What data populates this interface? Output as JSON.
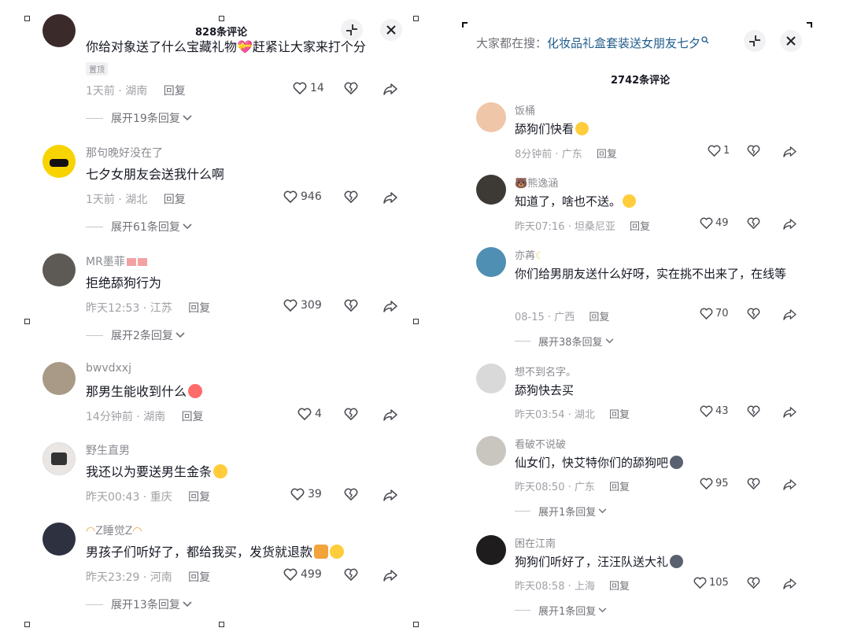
{
  "left": {
    "header": {
      "count_label": "828条评论"
    },
    "comments": [
      {
        "text": "你给对象送了什么宝藏礼物💝赶紧让大家来打个分",
        "pin": "置顶",
        "time": "1天前",
        "location": "湖南",
        "reply": "回复",
        "likes": "14",
        "expand": "展开19条回复"
      },
      {
        "user": "那句晚好没在了",
        "text": "七夕女朋友会送我什么啊",
        "time": "1天前",
        "location": "湖北",
        "reply": "回复",
        "likes": "946",
        "expand": "展开61条回复"
      },
      {
        "user": "MR墨菲",
        "text": "拒绝舔狗行为",
        "time": "昨天12:53",
        "location": "江苏",
        "reply": "回复",
        "likes": "309",
        "expand": "展开2条回复"
      },
      {
        "user": "bwvdxxj",
        "text": "那男生能收到什么",
        "time": "14分钟前",
        "location": "湖南",
        "reply": "回复",
        "likes": "4"
      },
      {
        "user": "野生直男",
        "text": "我还以为要送男生金条",
        "time": "昨天00:43",
        "location": "重庆",
        "reply": "回复",
        "likes": "39"
      },
      {
        "user": "Z睡觉Z",
        "text": "男孩子们听好了，都给我买，发货就退款",
        "time": "昨天23:29",
        "location": "河南",
        "reply": "回复",
        "likes": "499",
        "expand": "展开13条回复"
      }
    ]
  },
  "right": {
    "header": {
      "search_prefix": "大家都在搜：",
      "search_term": "化妆品礼盒套装送女朋友七夕",
      "count_label": "2742条评论"
    },
    "comments": [
      {
        "user": "饭桶",
        "text": "舔狗们快看",
        "time": "8分钟前",
        "location": "广东",
        "reply": "回复",
        "likes": "1"
      },
      {
        "user": "熊逸涵",
        "text": "知道了，啥也不送。",
        "time": "昨天07:16",
        "location": "坦桑尼亚",
        "reply": "回复",
        "likes": "49"
      },
      {
        "user": "亦苒",
        "text": "你们给男朋友送什么好呀，实在挑不出来了，在线等",
        "time": "08-15",
        "location": "广西",
        "reply": "回复",
        "likes": "70",
        "expand": "展开38条回复"
      },
      {
        "user": "想不到名字。",
        "text": "舔狗快去买",
        "time": "昨天03:54",
        "location": "湖北",
        "reply": "回复",
        "likes": "43"
      },
      {
        "user": "看破不说破",
        "text": "仙女们，快艾特你们的舔狗吧",
        "time": "昨天08:50",
        "location": "广东",
        "reply": "回复",
        "likes": "95",
        "expand": "展开1条回复"
      },
      {
        "user": "困在江南",
        "text": "狗狗们听好了，汪汪队送大礼",
        "time": "昨天08:58",
        "location": "上海",
        "reply": "回复",
        "likes": "105",
        "expand": "展开1条回复"
      }
    ]
  },
  "icons": {
    "heart": "heart-icon",
    "dislike": "broken-heart-icon",
    "share": "share-arrow-icon",
    "collapse": "collapse-arrows-icon",
    "close": "close-icon",
    "chevron": "chevron-down-icon",
    "search": "search-icon"
  },
  "colors": {
    "text": "#161823",
    "secondary": "#8a8b91",
    "meta": "#a0a1a6",
    "link": "#1f5b8a",
    "button_bg": "#f2f2f4"
  }
}
